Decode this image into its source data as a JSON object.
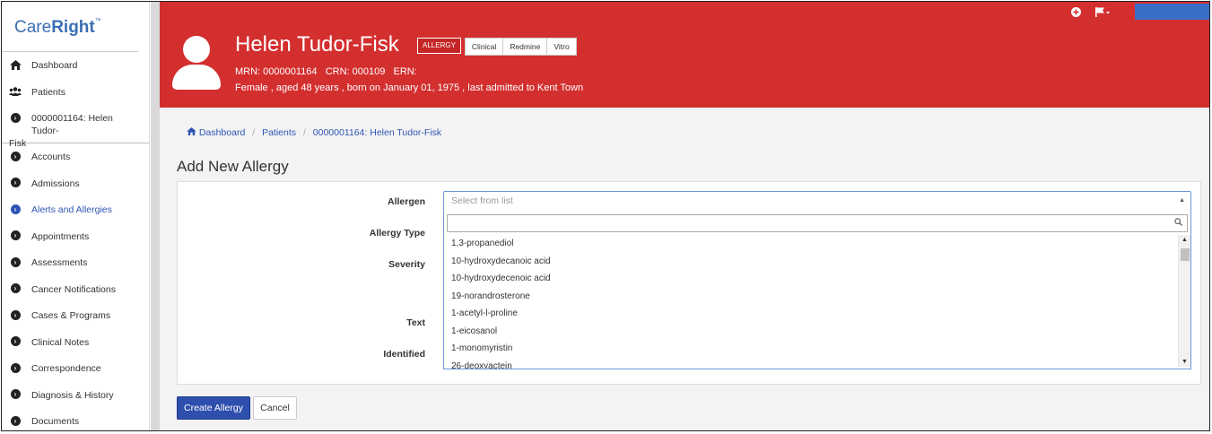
{
  "sidebar": {
    "logo_prefix": "Care",
    "logo_bold": "Right",
    "logo_tm": "™",
    "items": [
      {
        "label": "Dashboard",
        "icon": "home-icon"
      },
      {
        "label": "Patients",
        "icon": "users-icon"
      },
      {
        "label": "0000001164: Helen Tudor-",
        "label2": "Fisk",
        "icon": "chevron-circle-right-icon"
      },
      {
        "label": "Accounts"
      },
      {
        "label": "Admissions"
      },
      {
        "label": "Alerts and Allergies",
        "active": true
      },
      {
        "label": "Appointments"
      },
      {
        "label": "Assessments"
      },
      {
        "label": "Cancer Notifications"
      },
      {
        "label": "Cases & Programs"
      },
      {
        "label": "Clinical Notes"
      },
      {
        "label": "Correspondence"
      },
      {
        "label": "Diagnosis & History"
      },
      {
        "label": "Documents"
      }
    ]
  },
  "header": {
    "patient_name": "Helen Tudor-Fisk",
    "allergy_badge": "ALLERGY",
    "segments": [
      "Clinical",
      "Redmine",
      "Vitro"
    ],
    "ids_line": "MRN: 0000001164   CRN: 000109   ERN:",
    "demographics": "Female , aged 48 years , born on January 01, 1975 , last admitted to Kent Town",
    "accent_color": "#d42f2f"
  },
  "breadcrumb": {
    "home": "Dashboard",
    "patients": "Patients",
    "current": "0000001164: Helen Tudor-Fisk",
    "separator": "/"
  },
  "page_title": "Add New Allergy",
  "form": {
    "labels": {
      "allergen": "Allergen",
      "allergy_type": "Allergy Type",
      "severity": "Severity",
      "text": "Text",
      "identified": "Identified"
    },
    "allergen_placeholder": "Select from list",
    "options": [
      "1,3-propanediol",
      "10-hydroxydecanoic acid",
      "10-hydroxydecenoic acid",
      "19-norandrosterone",
      "1-acetyl-l-proline",
      "1-eicosanol",
      "1-monomyristin",
      "26-deoxyactein"
    ]
  },
  "buttons": {
    "create": "Create Allergy",
    "cancel": "Cancel"
  }
}
